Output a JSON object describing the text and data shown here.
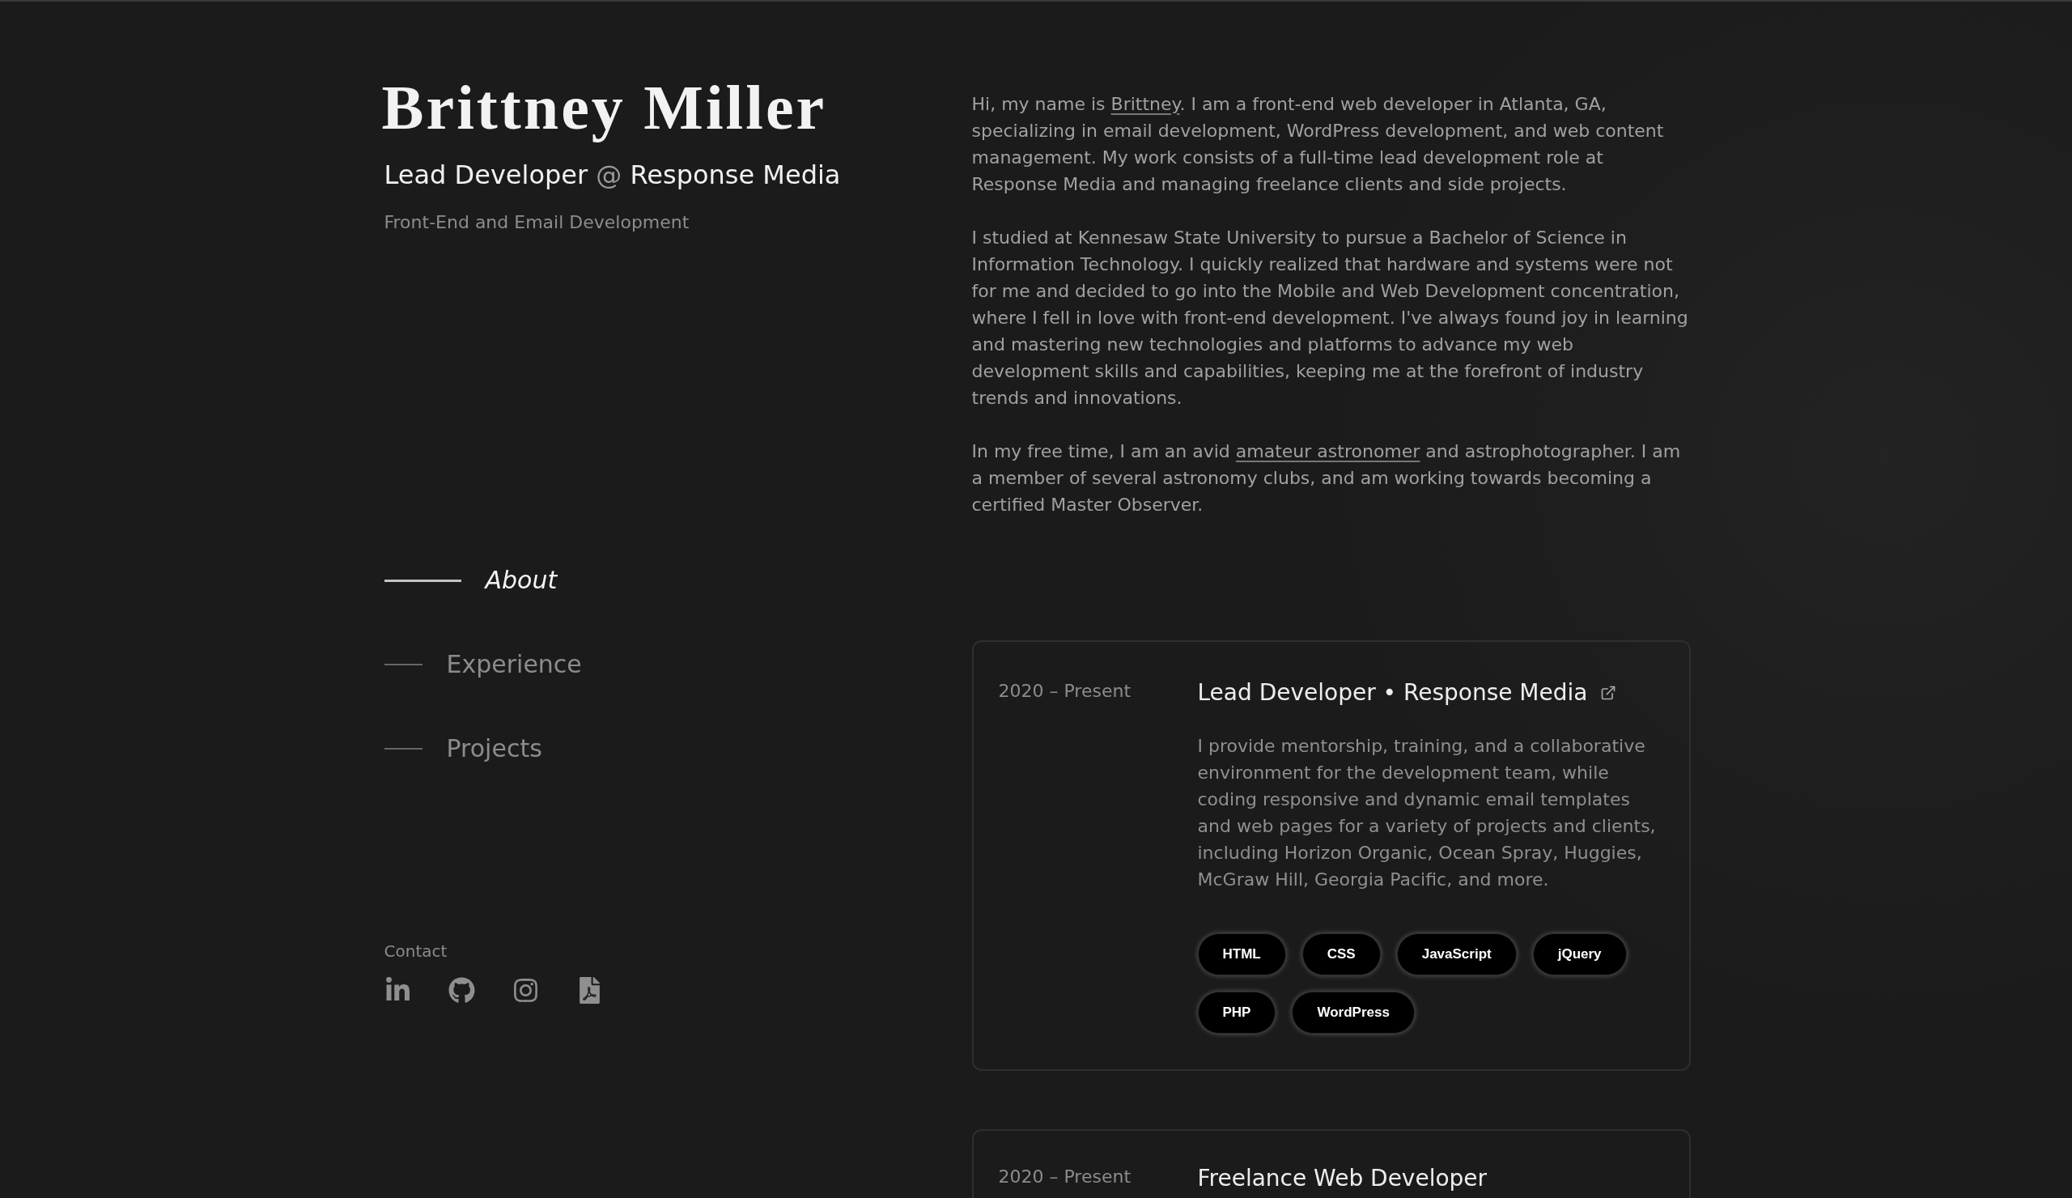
{
  "header": {
    "name": "Brittney Miller",
    "headline": {
      "role": "Lead Developer",
      "separator": "@",
      "company": "Response Media"
    },
    "tagline": "Front-End and Email Development"
  },
  "nav": [
    {
      "label": "About",
      "selected": true
    },
    {
      "label": "Experience",
      "selected": false
    },
    {
      "label": "Projects",
      "selected": false
    }
  ],
  "contact": {
    "label": "Contact"
  },
  "about": {
    "paragraphs": [
      [
        {
          "kind": "text",
          "text": "Hi, my name is "
        },
        {
          "kind": "link",
          "text": "Brittney"
        },
        {
          "kind": "text",
          "text": ". I am a front-end web developer in Atlanta, GA, specializing in email development, WordPress development, and web content management. My work consists of a full-time lead development role at Response Media and managing freelance clients and side projects."
        }
      ],
      [
        {
          "kind": "text",
          "text": "I studied at Kennesaw State University to pursue a Bachelor of Science in Information Technology. I quickly realized that hardware and systems were not for me and decided to go into the Mobile and Web Development concentration, where I fell in love with front-end development. I've always found joy in learning and mastering new technologies and platforms to advance my web development skills and capabilities, keeping me at the forefront of industry trends and innovations."
        }
      ],
      [
        {
          "kind": "text",
          "text": "In my free time, I am an avid "
        },
        {
          "kind": "link",
          "text": "amateur astronomer"
        },
        {
          "kind": "text",
          "text": " and astrophotographer. I am a member of several astronomy clubs, and am working towards becoming a certified Master Observer."
        }
      ]
    ]
  },
  "experience": [
    {
      "dates": "2020 – Present",
      "title": "Lead Developer • Response Media",
      "external_link": true,
      "description": "I provide mentorship, training, and a collaborative environment for the development team, while coding responsive and dynamic email templates and web pages for a variety of projects and clients, including Horizon Organic, Ocean Spray, Huggies, McGraw Hill, Georgia Pacific, and more.",
      "tags": [
        "HTML",
        "CSS",
        "JavaScript",
        "jQuery",
        "PHP",
        "WordPress"
      ]
    },
    {
      "dates": "2020 – Present",
      "title": "Freelance Web Developer",
      "external_link": false
    }
  ]
}
